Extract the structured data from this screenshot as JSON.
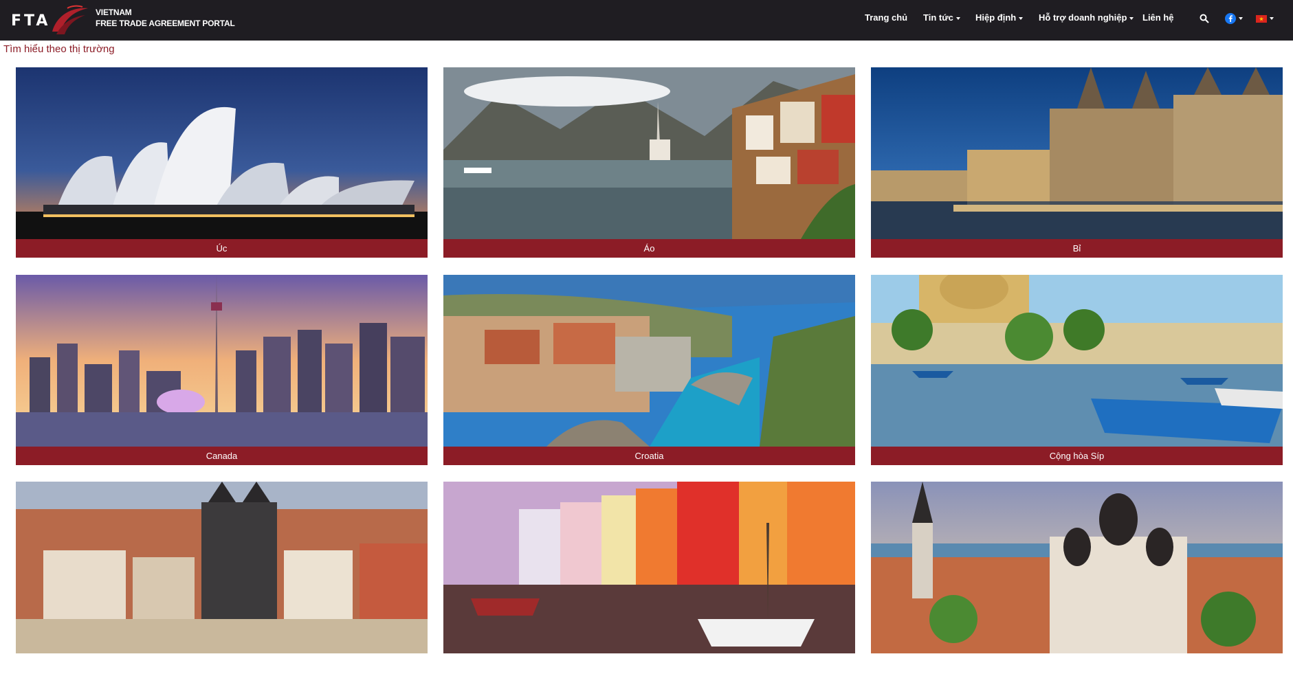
{
  "header": {
    "logo_text": "FTA",
    "brand_line1": "VIETNAM",
    "brand_line2": "FREE TRADE AGREEMENT PORTAL",
    "nav": [
      {
        "label": "Trang chủ",
        "dropdown": false
      },
      {
        "label": "Tin tức",
        "dropdown": true
      },
      {
        "label": "Hiệp định",
        "dropdown": true
      },
      {
        "label": "Hỗ trợ doanh nghiệp",
        "dropdown": true
      },
      {
        "label": "Liên hệ",
        "dropdown": false
      }
    ],
    "icons": [
      "search-icon",
      "facebook-icon",
      "vietnam-flag-icon"
    ]
  },
  "section": {
    "title": "Tìm hiểu theo thị trường"
  },
  "markets": [
    {
      "label": "Úc",
      "image": "sydney-opera-house"
    },
    {
      "label": "Áo",
      "image": "hallstatt-lake-village"
    },
    {
      "label": "Bỉ",
      "image": "ghent-canal-buildings"
    },
    {
      "label": "Canada",
      "image": "toronto-skyline"
    },
    {
      "label": "Croatia",
      "image": "dubrovnik-coast"
    },
    {
      "label": "Cộng hòa Síp",
      "image": "cyprus-harbour-boats"
    },
    {
      "label": "",
      "image": "prague-old-town"
    },
    {
      "label": "",
      "image": "copenhagen-nyhavn"
    },
    {
      "label": "",
      "image": "tallinn-cathedral"
    }
  ],
  "colors": {
    "header_bg": "#1f1d22",
    "accent": "#8c1c26",
    "text_on_dark": "#ffffff"
  }
}
